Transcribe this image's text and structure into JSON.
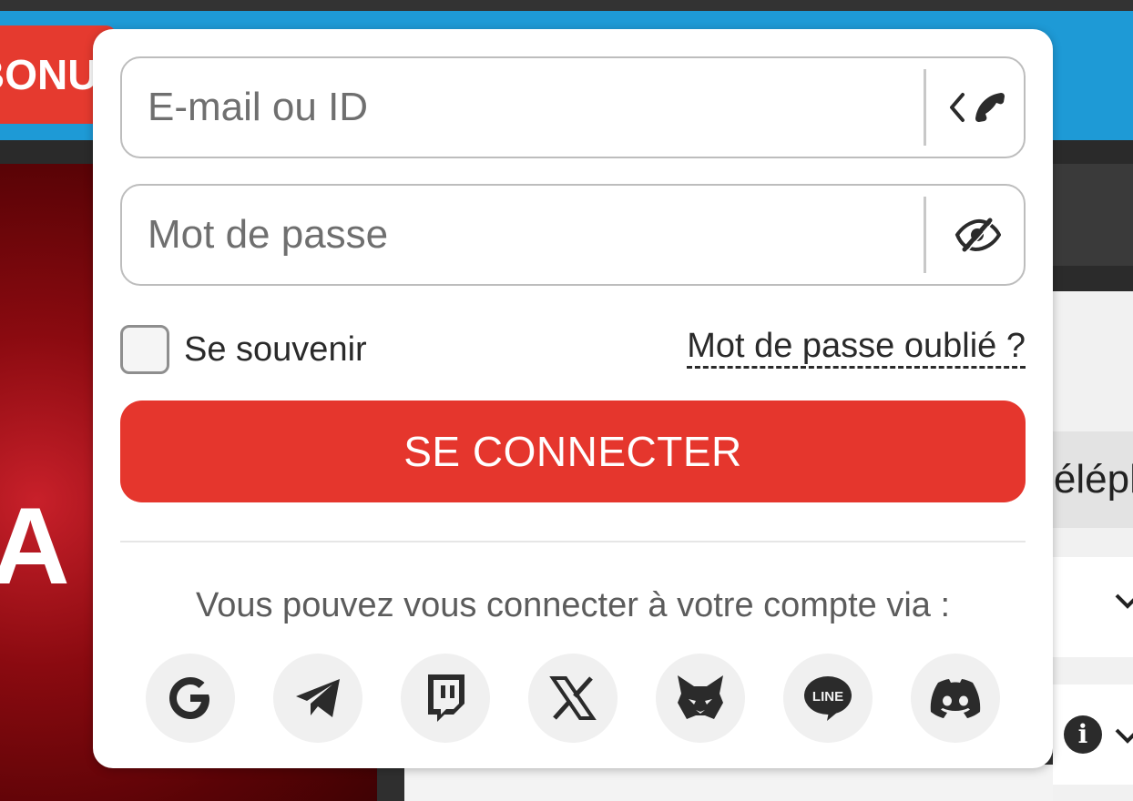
{
  "background": {
    "bonus_button_label": "BONUS",
    "hero_letter": "A",
    "tab_label": "Téléphone"
  },
  "login": {
    "email_placeholder": "E-mail ou ID",
    "password_placeholder": "Mot de passe",
    "remember_label": "Se souvenir",
    "forgot_label": "Mot de passe oublié ?",
    "submit_label": "SE CONNECTER",
    "social_intro": "Vous pouvez vous connecter à votre compte via :",
    "social_providers": [
      {
        "name": "Google",
        "icon": "google-icon"
      },
      {
        "name": "Telegram",
        "icon": "telegram-icon"
      },
      {
        "name": "Twitch",
        "icon": "twitch-icon"
      },
      {
        "name": "X",
        "icon": "x-icon"
      },
      {
        "name": "MetaMask",
        "icon": "metamask-icon"
      },
      {
        "name": "LINE",
        "icon": "line-icon",
        "badge_text": "LINE"
      },
      {
        "name": "Discord",
        "icon": "discord-icon"
      }
    ]
  },
  "colors": {
    "accent_red": "#e5362d",
    "header_blue": "#1e9ad6",
    "icon_dark": "#2b2b2b"
  }
}
